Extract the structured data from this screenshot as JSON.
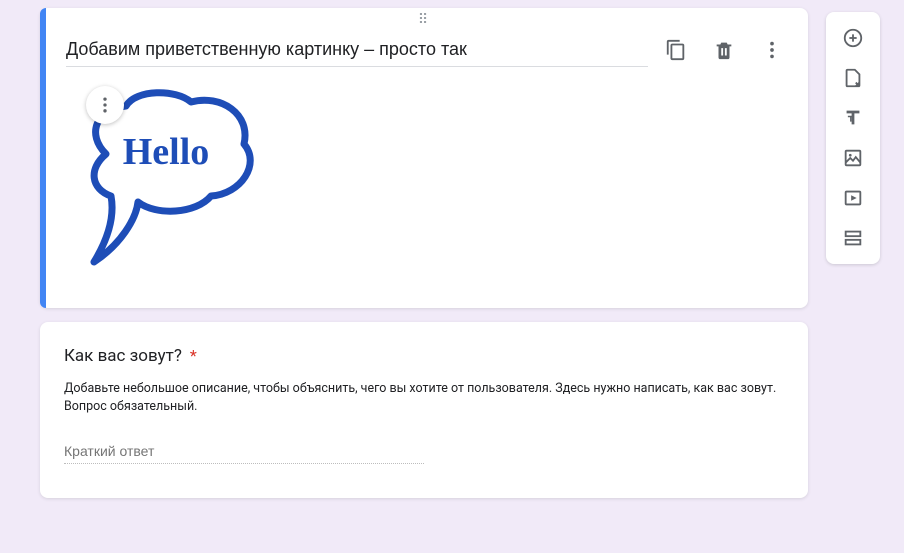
{
  "image_card": {
    "title": "Добавим приветственную картинку – просто так",
    "image_text": "Hello"
  },
  "question_card": {
    "title": "Как вас зовут?",
    "required_marker": "*",
    "description": "Добавьте небольшое описание, чтобы объяснить, чего вы хотите от пользователя. Здесь нужно написать, как вас зовут. Вопрос обязательный.",
    "answer_placeholder": "Краткий ответ"
  },
  "actions": {
    "copy": "Копировать",
    "delete": "Удалить",
    "more": "Ещё"
  },
  "toolbar": {
    "add_question": "Добавить вопрос",
    "import_questions": "Импортировать вопросы",
    "add_title": "Добавить название и описание",
    "add_image": "Добавить изображение",
    "add_video": "Добавить видео",
    "add_section": "Добавить раздел"
  }
}
